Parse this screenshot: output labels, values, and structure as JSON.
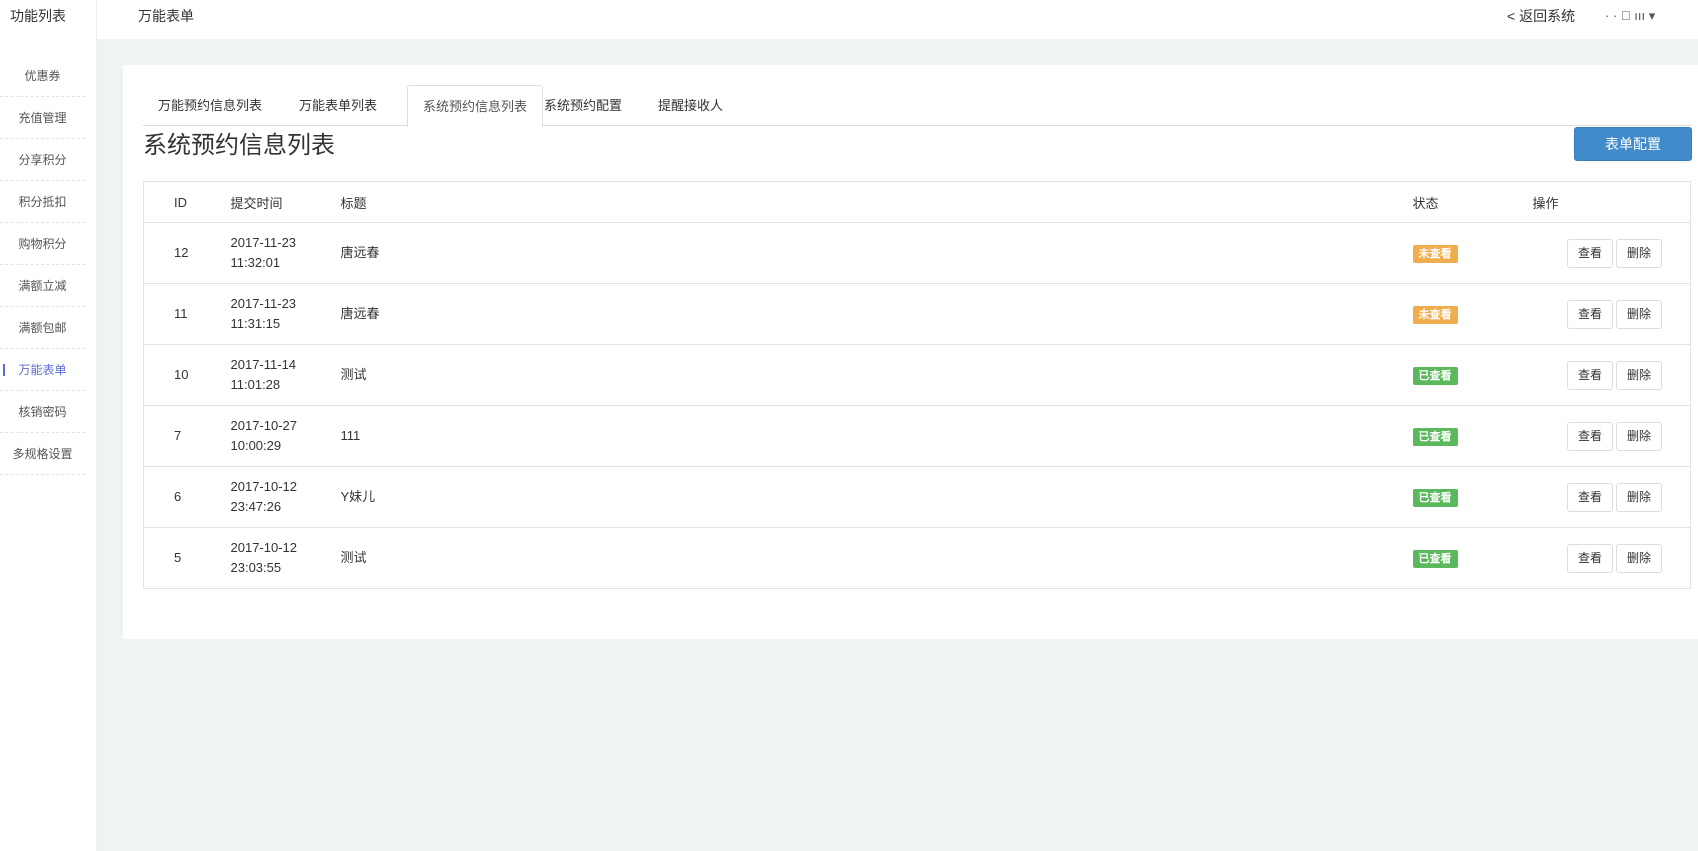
{
  "header": {
    "sidebar_title": "功能列表",
    "page_name": "万能表单",
    "back": "< 返回系统",
    "user": "· ·  ﾞ  ııı ▾"
  },
  "sidebar": {
    "items": [
      {
        "label": "优惠券"
      },
      {
        "label": "充值管理"
      },
      {
        "label": "分享积分"
      },
      {
        "label": "积分抵扣"
      },
      {
        "label": "购物积分"
      },
      {
        "label": "满额立减"
      },
      {
        "label": "满额包邮"
      },
      {
        "label": "万能表单",
        "active": true
      },
      {
        "label": "核销密码"
      },
      {
        "label": "多规格设置"
      }
    ]
  },
  "tabs": [
    {
      "label": "万能预约信息列表"
    },
    {
      "label": "万能表单列表"
    },
    {
      "label": "系统预约信息列表",
      "active": true
    },
    {
      "label": "系统预约配置"
    },
    {
      "label": "提醒接收人"
    }
  ],
  "main": {
    "title": "系统预约信息列表",
    "config_button": "表单配置"
  },
  "table": {
    "headers": {
      "id": "ID",
      "time": "提交时间",
      "title": "标题",
      "status": "状态",
      "actions": "操作"
    },
    "view_label": "查看",
    "delete_label": "删除",
    "rows": [
      {
        "id": "12",
        "date": "2017-11-23",
        "time": "11:32:01",
        "title": "唐远春",
        "status": "未查看",
        "status_color": "#f0ad4e"
      },
      {
        "id": "11",
        "date": "2017-11-23",
        "time": "11:31:15",
        "title": "唐远春",
        "status": "未查看",
        "status_color": "#f0ad4e"
      },
      {
        "id": "10",
        "date": "2017-11-14",
        "time": "11:01:28",
        "title": "测试",
        "status": "已查看",
        "status_color": "#5cb85c"
      },
      {
        "id": "7",
        "date": "2017-10-27",
        "time": "10:00:29",
        "title": "111",
        "status": "已查看",
        "status_color": "#5cb85c"
      },
      {
        "id": "6",
        "date": "2017-10-12",
        "time": "23:47:26",
        "title": "Y妹儿",
        "status": "已查看",
        "status_color": "#5cb85c"
      },
      {
        "id": "5",
        "date": "2017-10-12",
        "time": "23:03:55",
        "title": "测试",
        "status": "已查看",
        "status_color": "#5cb85c"
      }
    ]
  }
}
